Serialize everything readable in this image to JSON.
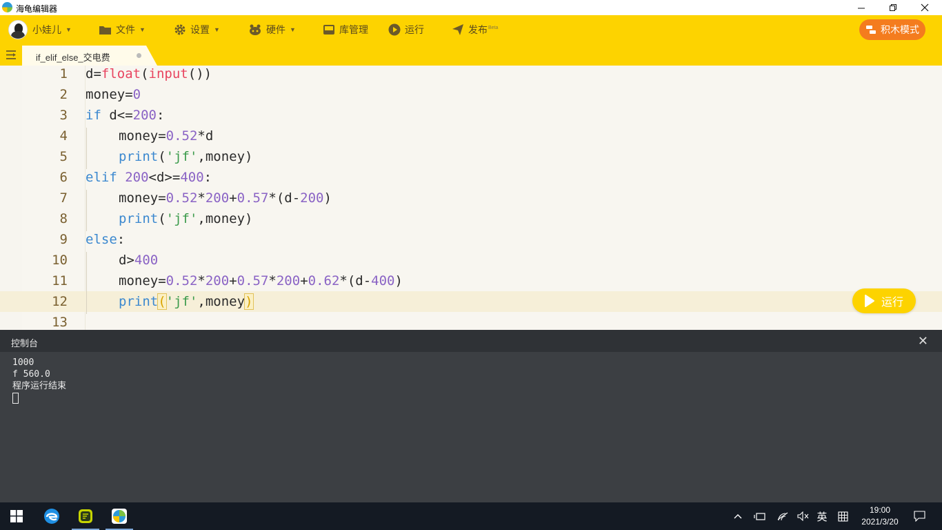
{
  "window": {
    "title": "海龟编辑器"
  },
  "toolbar": {
    "user": "小娃儿",
    "file": "文件",
    "settings": "设置",
    "hardware": "硬件",
    "library": "库管理",
    "run": "运行",
    "publish": "发布",
    "publish_badge": "Beta",
    "block_mode": "积木模式"
  },
  "tab": {
    "label": "if_elif_else_交电费"
  },
  "editor": {
    "line_numbers": [
      "1",
      "2",
      "3",
      "4",
      "5",
      "6",
      "7",
      "8",
      "9",
      "10",
      "11",
      "12",
      "13"
    ],
    "run_button": "运行"
  },
  "code": {
    "l1": {
      "a": "d=",
      "b": "float",
      "c": "(",
      "d": "input",
      "e": "())"
    },
    "l2": {
      "a": "money=",
      "b": "0"
    },
    "l3": {
      "a": "if",
      "b": " d<=",
      "c": "200",
      "d": ":"
    },
    "l4": {
      "a": "money=",
      "b": "0.52",
      "c": "*d"
    },
    "l5": {
      "a": "print",
      "b": "(",
      "c": "'jf'",
      "d": ",money)"
    },
    "l6": {
      "a": "elif",
      "b": " ",
      "c": "200",
      "d": "<d>=",
      "e": "400",
      "f": ":"
    },
    "l7": {
      "a": "money=",
      "b": "0.52",
      "c": "*",
      "d": "200",
      "e": "+",
      "f": "0.57",
      "g": "*(d-",
      "h": "200",
      "i": ")"
    },
    "l8": {
      "a": "print",
      "b": "(",
      "c": "'jf'",
      "d": ",money)"
    },
    "l9": {
      "a": "else",
      "b": ":"
    },
    "l10": {
      "a": "d>",
      "b": "400"
    },
    "l11": {
      "a": "money=",
      "b": "0.52",
      "c": "*",
      "d": "200",
      "e": "+",
      "f": "0.57",
      "g": "*",
      "h": "200",
      "i": "+",
      "j": "0.62",
      "k": "*(d-",
      "l": "400",
      "m": ")"
    },
    "l12": {
      "a": "print",
      "b": "(",
      "c": "'jf'",
      "d": ",money",
      "e": ")"
    }
  },
  "console": {
    "title": "控制台",
    "close": "✕",
    "lines": [
      "1000",
      "f 560.0",
      "程序运行结束"
    ]
  },
  "taskbar": {
    "input_lang": "英",
    "time": "19:00",
    "date": "2021/3/20"
  }
}
